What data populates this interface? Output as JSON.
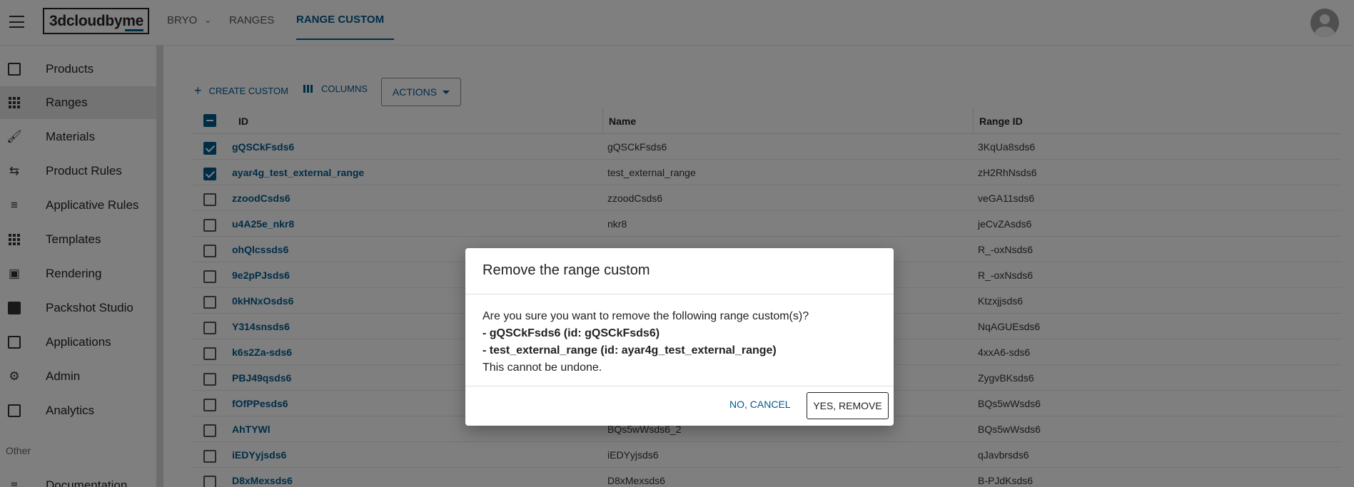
{
  "appbar": {
    "logo": "3dcloudbyme",
    "tabs": [
      {
        "label": "BRYO"
      },
      {
        "label": "RANGES"
      },
      {
        "label": "RANGE CUSTOM"
      }
    ]
  },
  "sidebar": {
    "items": [
      {
        "label": "Products",
        "icon": "products-icon"
      },
      {
        "label": "Ranges",
        "icon": "ranges-icon"
      },
      {
        "label": "Materials",
        "icon": "materials-icon"
      },
      {
        "label": "Product Rules",
        "icon": "product-rules-icon"
      },
      {
        "label": "Applicative Rules",
        "icon": "applicative-rules-icon"
      },
      {
        "label": "Templates",
        "icon": "templates-icon"
      },
      {
        "label": "Rendering",
        "icon": "camera-icon"
      },
      {
        "label": "Packshot Studio",
        "icon": "packshot-icon"
      },
      {
        "label": "Applications",
        "icon": "applications-icon"
      },
      {
        "label": "Admin",
        "icon": "gear-icon"
      },
      {
        "label": "Analytics",
        "icon": "analytics-icon"
      }
    ],
    "other_label": "Other",
    "documentation": "Documentation"
  },
  "toolbar": {
    "create": "CREATE CUSTOM",
    "columns": "COLUMNS",
    "actions": "ACTIONS"
  },
  "table": {
    "headers": [
      "ID",
      "Name",
      "Range ID"
    ],
    "rows": [
      {
        "id": "gQSCkFsds6",
        "name": "gQSCkFsds6",
        "range_id": "3KqUa8sds6",
        "checked": true
      },
      {
        "id": "ayar4g_test_external_range",
        "name": "test_external_range",
        "range_id": "zH2RhNsds6",
        "checked": true
      },
      {
        "id": "zzoodCsds6",
        "name": "zzoodCsds6",
        "range_id": "veGA11sds6",
        "checked": false
      },
      {
        "id": "u4A25e_nkr8",
        "name": "nkr8",
        "range_id": "jeCvZAsds6",
        "checked": false
      },
      {
        "id": "ohQlcssds6",
        "name": "",
        "range_id": "R_-oxNsds6",
        "checked": false
      },
      {
        "id": "9e2pPJsds6",
        "name": "",
        "range_id": "R_-oxNsds6",
        "checked": false
      },
      {
        "id": "0kHNxOsds6",
        "name": "",
        "range_id": "Ktzxjjsds6",
        "checked": false
      },
      {
        "id": "Y314snsds6",
        "name": "",
        "range_id": "NqAGUEsds6",
        "checked": false
      },
      {
        "id": "k6s2Za-sds6",
        "name": "",
        "range_id": "4xxA6-sds6",
        "checked": false
      },
      {
        "id": "PBJ49qsds6",
        "name": "",
        "range_id": "ZygvBKsds6",
        "checked": false
      },
      {
        "id": "fOfPPesds6",
        "name": "",
        "range_id": "BQs5wWsds6",
        "checked": false
      },
      {
        "id": "AhTYWl",
        "name": "BQs5wWsds6_2",
        "range_id": "BQs5wWsds6",
        "checked": false
      },
      {
        "id": "iEDYyjsds6",
        "name": "iEDYyjsds6",
        "range_id": "qJavbrsds6",
        "checked": false
      },
      {
        "id": "D8xMexsds6",
        "name": "D8xMexsds6",
        "range_id": "B-PJdKsds6",
        "checked": false
      }
    ]
  },
  "dialog": {
    "title": "Remove the range custom",
    "question": "Are you sure you want to remove the following range custom(s)?",
    "item1": "- gQSCkFsds6 (id: gQSCkFsds6)",
    "item2": "- test_external_range (id: ayar4g_test_external_range)",
    "warning": "This cannot be undone.",
    "cancel": "NO, CANCEL",
    "confirm": "YES, REMOVE"
  },
  "colors": {
    "accent": "#005a8d",
    "overlay": "rgba(0,0,0,0.5)"
  }
}
